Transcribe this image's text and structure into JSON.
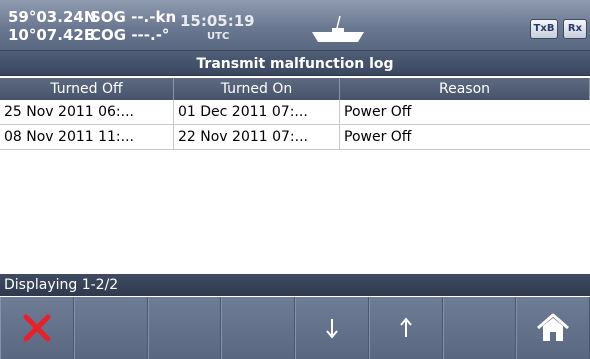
{
  "status": {
    "lat": "59°03.24N",
    "lon": "10°07.42E",
    "sog_label": "SOG",
    "sog_value": "--.-kn",
    "cog_label": "COG",
    "cog_value": "---.-°",
    "time": "15:05:19",
    "time_zone": "UTC",
    "txb": "TxB",
    "rx": "Rx"
  },
  "title": "Transmit malfunction log",
  "table": {
    "columns": [
      "Turned Off",
      "Turned On",
      "Reason"
    ],
    "rows": [
      [
        "25 Nov 2011 06:...",
        "01 Dec 2011 07:...",
        "Power Off"
      ],
      [
        "08 Nov 2011 11:...",
        "22 Nov 2011 07:...",
        "Power Off"
      ]
    ]
  },
  "footer": "Displaying 1-2/2",
  "buttons": [
    {
      "icon": "close-icon"
    },
    {
      "icon": ""
    },
    {
      "icon": ""
    },
    {
      "icon": ""
    },
    {
      "icon": "arrow-down-icon"
    },
    {
      "icon": "arrow-up-icon"
    },
    {
      "icon": ""
    },
    {
      "icon": "home-icon"
    }
  ]
}
